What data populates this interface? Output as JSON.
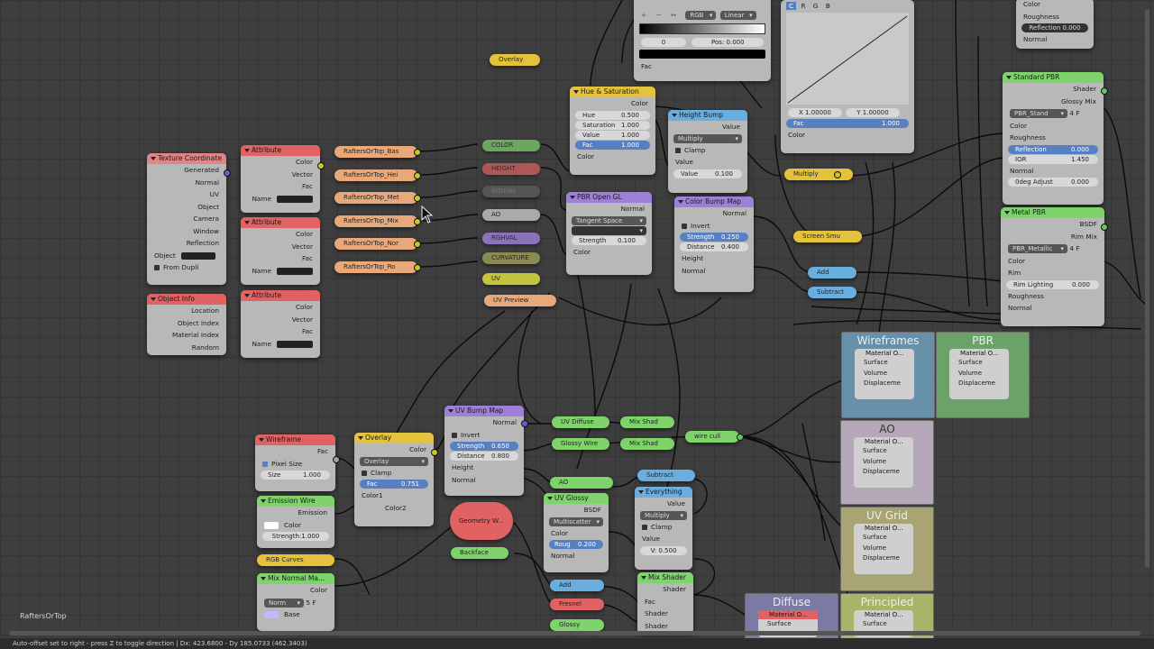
{
  "editor": {
    "name_label": "RaftersOrTop"
  },
  "status_text": "Auto-offset set to right - press Z to toggle direction   |   Dx: 423.6800 - Dy 185.0733 (462.3403)",
  "colors": {
    "coord": "#e08484",
    "attr": "#e06262",
    "info": "#e06262",
    "reroute": "#e8a87a",
    "yellow": "#e4c23e",
    "green": "#7ed46a",
    "blue": "#6aaee0",
    "purple": "#a07fd8",
    "pink": "#e08484"
  },
  "texcoord": {
    "title": "Texture Coordinate",
    "outputs": [
      "Generated",
      "Normal",
      "UV",
      "Object",
      "Camera",
      "Window",
      "Reflection"
    ],
    "object_label": "Object",
    "from_dupli": "From Dupli"
  },
  "objinfo": {
    "title": "Object Info",
    "outputs": [
      "Location",
      "Object Index",
      "Material Index",
      "Random"
    ]
  },
  "attribute": {
    "title": "Attribute",
    "outputs": [
      "Color",
      "Vector",
      "Fac"
    ],
    "name_label": "Name"
  },
  "reroutes": [
    "RaftersOrTop_Bas",
    "RaftersOrTop_Hei",
    "RaftersOrTop_Met",
    "RaftersOrTop_Mix",
    "RaftersOrTop_Nor",
    "RaftersOrTop_Ro"
  ],
  "mini_nodes": [
    "COLOR",
    "HEIGHT",
    "ROUGH",
    "AO",
    "RGHVAL",
    "CURVATURE",
    "UV"
  ],
  "uv_preview": "UV Preview",
  "overlay_top": "Overlay",
  "color_ramp": {
    "mode": "RGB",
    "interp": "Linear",
    "pos_index": "0",
    "pos_label": "Pos:",
    "pos_value": "0.000",
    "fac": "Fac",
    "icons": [
      "+",
      "−",
      "↔"
    ]
  },
  "curves": {
    "tabs": [
      "C",
      "R",
      "G",
      "B"
    ],
    "x": "X 1.00000",
    "y": "Y 1.00000",
    "fac_label": "Fac",
    "fac_value": "1.000",
    "color": "Color"
  },
  "hue_sat": {
    "title": "Hue & Saturation",
    "out": "Color",
    "hue": "Hue",
    "hue_v": "0.500",
    "sat": "Saturation",
    "sat_v": "1.000",
    "val": "Value",
    "val_v": "1.000",
    "fac": "Fac",
    "fac_v": "1.000",
    "color": "Color"
  },
  "height_bump": {
    "title": "Height Bump",
    "out": "Value",
    "mode": "Multiply",
    "clamp": "Clamp",
    "value": "Value",
    "value_label": "Value",
    "value_v": "0.100"
  },
  "pbr_open": {
    "title": "PBR Open GL",
    "out": "Normal",
    "space": "Tangent Space",
    "strength": "Strength",
    "strength_v": "0.100",
    "color": "Color"
  },
  "color_bump": {
    "title": "Color Bump Map",
    "out": "Normal",
    "invert": "Invert",
    "strength": "Strength",
    "strength_v": "0.250",
    "distance": "Distance",
    "distance_v": "0.400",
    "height": "Height",
    "normal": "Normal"
  },
  "multiply_pill": "Multiply",
  "screen_pill": "Screen Smu",
  "add_pill": "Add",
  "subtract_pill": "Subtract",
  "std_pbr": {
    "title": "Standard PBR",
    "outs": [
      "Shader",
      "Glossy Mix"
    ],
    "name": "PBR_Stand",
    "count": "4",
    "f": "F",
    "color": "Color",
    "rough": "Roughness",
    "refl": "Reflection",
    "refl_v": "0.000",
    "ior": "IOR",
    "ior_v": "1.450",
    "normal": "Normal",
    "deg": "0deg Adjust",
    "deg_v": "0.000"
  },
  "metal_pbr": {
    "title": "Metal PBR",
    "outs": [
      "BSDF",
      "Rim Mix"
    ],
    "name": "PBR_Metallic",
    "count": "4",
    "f": "F",
    "color": "Color",
    "rim": "Rim",
    "rim_light": "Rim Lighting",
    "rim_light_v": "0.000",
    "rough": "Roughness",
    "normal": "Normal"
  },
  "top_right": {
    "color": "Color",
    "rough": "Roughness",
    "refl": "Reflection",
    "refl_v": "0.000",
    "normal": "Normal"
  },
  "frames": {
    "wireframes": "Wireframes",
    "pbr": "PBR",
    "ao": "AO",
    "uvgrid": "UV Grid",
    "diffuse": "Diffuse",
    "principled": "Principled",
    "mat_title": "Material O...",
    "mat_rows": [
      "Surface",
      "Volume",
      "Displaceme"
    ]
  },
  "wireframe": {
    "title": "Wireframe",
    "out": "Fac",
    "pixel": "Pixel Size",
    "size": "Size",
    "size_v": "1.000"
  },
  "emission_wire": {
    "title": "Emission Wire",
    "out": "Emission",
    "color": "Color",
    "strength": "Strength",
    "strength_v": "1.000"
  },
  "rgb_curves": "RGB Curves",
  "mix_normal": {
    "title": "Mix Normal Ma...",
    "out": "Color",
    "mode": "Norm",
    "num": "5",
    "f": "F",
    "base": "Base"
  },
  "overlay_node": {
    "title": "Overlay",
    "out": "Color",
    "mode": "Overlay",
    "clamp": "Clamp",
    "fac": "Fac",
    "fac_v": "0.751",
    "c1": "Color1",
    "c2": "Color2"
  },
  "uv_bump": {
    "title": "UV Bump Map",
    "out": "Normal",
    "invert": "Invert",
    "strength": "Strength",
    "strength_v": "0.650",
    "distance": "Distance",
    "distance_v": "0.800",
    "height": "Height",
    "normal": "Normal"
  },
  "geometry": "Geometry W...",
  "backface": "Backface",
  "uv_diffuse": "UV Diffuse",
  "glossy_wire": "Glossy Wire",
  "mix_shad_1": "Mix Shad",
  "mix_shad_2": "Mix Shad",
  "wire_cull": "wire cull",
  "ao_pill": "AO",
  "uv_glossy": {
    "title": "UV Glossy",
    "out": "BSDF",
    "dist": "Multiscatter",
    "color": "Color",
    "rough": "Roug",
    "rough_v": "0.200",
    "normal": "Normal"
  },
  "subtract2": "Subtract",
  "everything": {
    "title": "Everything",
    "out": "Value",
    "mode": "Multiply",
    "clamp": "Clamp",
    "value": "Value",
    "v_label": "V",
    "v_value": "0.500"
  },
  "mix_shader": {
    "title": "Mix Shader",
    "out": "Shader",
    "fac": "Fac",
    "s1": "Shader",
    "s2": "Shader"
  },
  "add2": "Add",
  "fresnel": "Fresnel",
  "glossy": "Glossy"
}
